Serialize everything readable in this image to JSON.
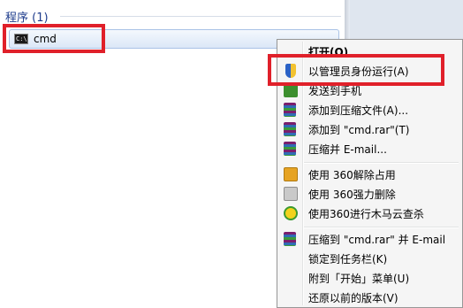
{
  "start_menu": {
    "section_header": "程序 (1)",
    "program": {
      "label": "cmd",
      "icon": "cmd-console-icon"
    }
  },
  "context_menu": {
    "items": [
      {
        "label": "打开(O)",
        "bold": true,
        "icon": ""
      },
      {
        "label": "以管理员身份运行(A)",
        "icon": "uac-shield-icon"
      },
      {
        "label": "发送到手机",
        "icon": "send-to-phone-icon"
      },
      {
        "label": "添加到压缩文件(A)...",
        "icon": "winrar-icon"
      },
      {
        "label": "添加到 \"cmd.rar\"(T)",
        "icon": "winrar-icon"
      },
      {
        "label": "压缩并 E-mail...",
        "icon": "winrar-icon"
      },
      {
        "label": "使用 360解除占用",
        "icon": "360-unlock-icon"
      },
      {
        "label": "使用 360强力删除",
        "icon": "360-shred-icon"
      },
      {
        "label": "使用360进行木马云查杀",
        "icon": "360-scan-icon"
      },
      {
        "label": "压缩到 \"cmd.rar\" 并 E-mail",
        "icon": "winrar-icon"
      },
      {
        "label": "锁定到任务栏(K)",
        "icon": ""
      },
      {
        "label": "附到「开始」菜单(U)",
        "icon": ""
      },
      {
        "label": "还原以前的版本(V)",
        "icon": ""
      }
    ]
  },
  "colors": {
    "highlight_box": "#e0202a",
    "header_text": "#1e3c8c"
  }
}
